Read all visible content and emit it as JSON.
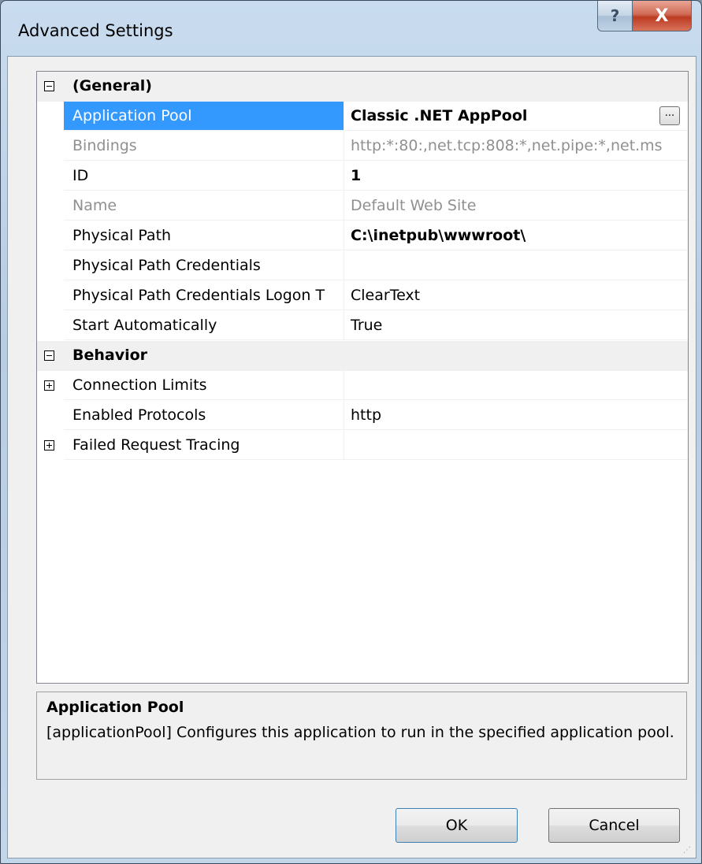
{
  "window": {
    "title": "Advanced Settings",
    "help_glyph": "?",
    "close_glyph": "X"
  },
  "grid": {
    "rows": [
      {
        "kind": "category",
        "label": "(General)",
        "expander": "minus"
      },
      {
        "kind": "property",
        "name": "Application Pool",
        "value": "Classic .NET AppPool",
        "selected": true,
        "bold_value": true,
        "has_ellipsis": true
      },
      {
        "kind": "property",
        "name": "Bindings",
        "value": "http:*:80:,net.tcp:808:*,net.pipe:*,net.ms",
        "disabled": true
      },
      {
        "kind": "property",
        "name": "ID",
        "value": "1",
        "bold_value": true
      },
      {
        "kind": "property",
        "name": "Name",
        "value": "Default Web Site",
        "disabled": true
      },
      {
        "kind": "property",
        "name": "Physical Path",
        "value": "C:\\inetpub\\wwwroot\\",
        "bold_value": true
      },
      {
        "kind": "property",
        "name": "Physical Path Credentials",
        "value": ""
      },
      {
        "kind": "property",
        "name": "Physical Path Credentials Logon T",
        "value": "ClearText"
      },
      {
        "kind": "property",
        "name": "Start Automatically",
        "value": "True"
      },
      {
        "kind": "category",
        "label": "Behavior",
        "expander": "minus"
      },
      {
        "kind": "property",
        "name": "Connection Limits",
        "value": "",
        "expander": "plus"
      },
      {
        "kind": "property",
        "name": "Enabled Protocols",
        "value": "http"
      },
      {
        "kind": "property",
        "name": "Failed Request Tracing",
        "value": "",
        "expander": "plus"
      }
    ],
    "ellipsis_label": "..."
  },
  "description": {
    "title": "Application Pool",
    "text": "[applicationPool] Configures this application to run in the specified application pool."
  },
  "buttons": {
    "ok": "OK",
    "cancel": "Cancel"
  }
}
